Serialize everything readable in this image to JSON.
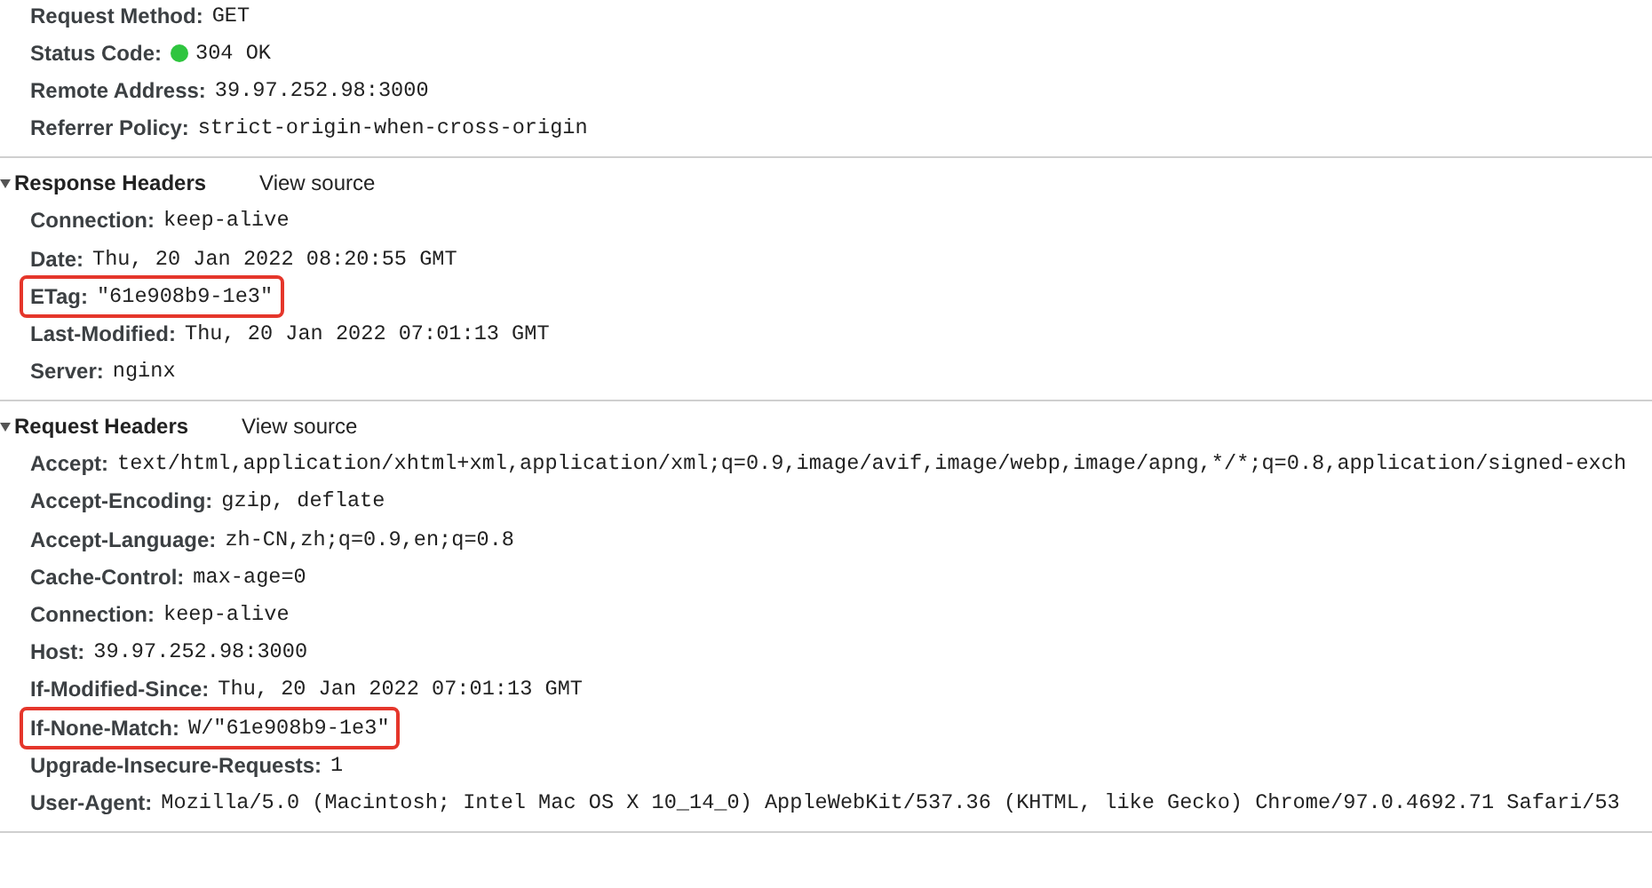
{
  "general": [
    {
      "name": "Request Method:",
      "value": "GET",
      "highlighted": false
    },
    {
      "name": "Status Code:",
      "value": "304 OK",
      "color": "#2fc53f",
      "highlighted": false
    },
    {
      "name": "Remote Address:",
      "value": "39.97.252.98:3000",
      "highlighted": false
    },
    {
      "name": "Referrer Policy:",
      "value": "strict-origin-when-cross-origin",
      "highlighted": false
    }
  ],
  "sections": [
    {
      "title": "Response Headers",
      "view_source": "View source",
      "expanded": true,
      "headers": [
        {
          "name": "Connection:",
          "value": "keep-alive",
          "highlighted": false
        },
        {
          "name": "Date:",
          "value": "Thu, 20 Jan 2022 08:20:55 GMT",
          "highlighted": false
        },
        {
          "name": "ETag:",
          "value": "\"61e908b9-1e3\"",
          "highlighted": true
        },
        {
          "name": "Last-Modified:",
          "value": "Thu, 20 Jan 2022 07:01:13 GMT",
          "highlighted": false
        },
        {
          "name": "Server:",
          "value": "nginx",
          "highlighted": false
        }
      ]
    },
    {
      "title": "Request Headers",
      "view_source": "View source",
      "expanded": true,
      "headers": [
        {
          "name": "Accept:",
          "value": "text/html,application/xhtml+xml,application/xml;q=0.9,image/avif,image/webp,image/apng,*/*;q=0.8,application/signed-exch",
          "highlighted": false
        },
        {
          "name": "Accept-Encoding:",
          "value": "gzip, deflate",
          "highlighted": false
        },
        {
          "name": "Accept-Language:",
          "value": "zh-CN,zh;q=0.9,en;q=0.8",
          "highlighted": false
        },
        {
          "name": "Cache-Control:",
          "value": "max-age=0",
          "highlighted": false
        },
        {
          "name": "Connection:",
          "value": "keep-alive",
          "highlighted": false
        },
        {
          "name": "Host:",
          "value": "39.97.252.98:3000",
          "highlighted": false
        },
        {
          "name": "If-Modified-Since:",
          "value": "Thu, 20 Jan 2022 07:01:13 GMT",
          "highlighted": false
        },
        {
          "name": "If-None-Match:",
          "value": "W/\"61e908b9-1e3\"",
          "highlighted": true
        },
        {
          "name": "Upgrade-Insecure-Requests:",
          "value": "1",
          "highlighted": false
        },
        {
          "name": "User-Agent:",
          "value": "Mozilla/5.0 (Macintosh; Intel Mac OS X 10_14_0) AppleWebKit/537.36 (KHTML, like Gecko) Chrome/97.0.4692.71 Safari/53",
          "highlighted": false
        }
      ]
    }
  ]
}
